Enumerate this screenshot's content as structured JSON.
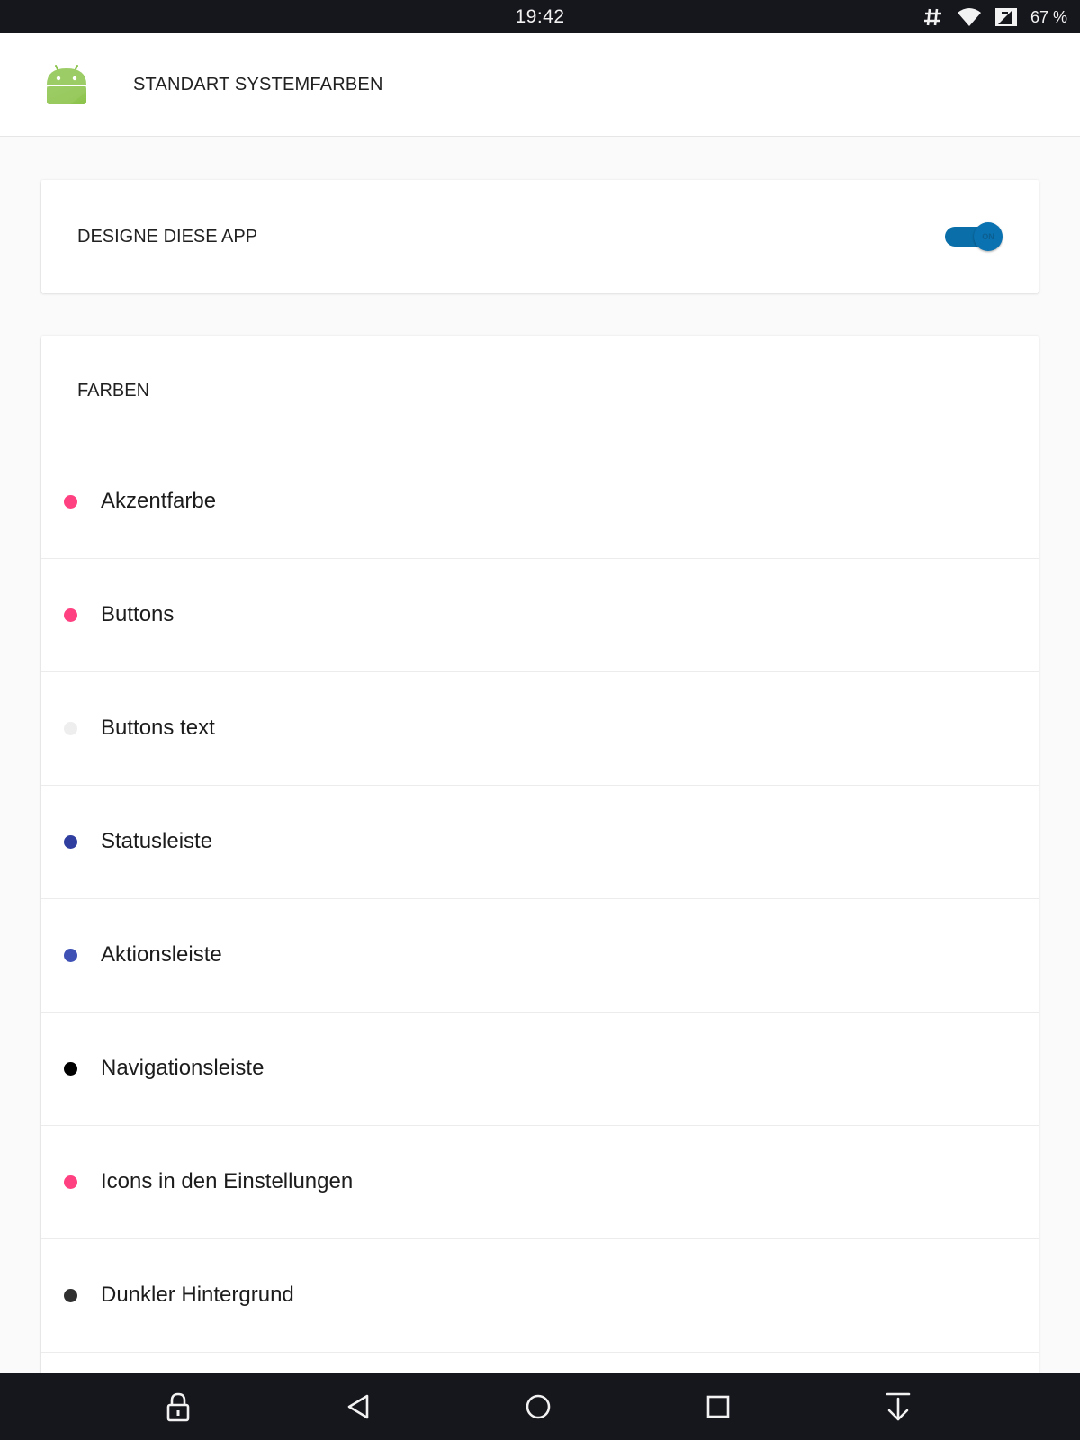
{
  "status_bar": {
    "time": "19:42",
    "battery": "67 %",
    "icons": [
      "hash-icon",
      "wifi-icon",
      "no-sim-icon"
    ]
  },
  "header": {
    "title": "STANDART SYSTEMFARBEN",
    "logo": "android-logo"
  },
  "design_card": {
    "label": "DESIGNE DIESE APP",
    "toggle": {
      "state": "ON",
      "checked": true,
      "color": "#0a72b0"
    }
  },
  "colors_card": {
    "title": "FARBEN",
    "items": [
      {
        "label": "Akzentfarbe",
        "color": "#ff4081"
      },
      {
        "label": "Buttons",
        "color": "#ff4081"
      },
      {
        "label": "Buttons text",
        "color": "#eeeeee"
      },
      {
        "label": "Statusleiste",
        "color": "#303f9f"
      },
      {
        "label": "Aktionsleiste",
        "color": "#3f51b5"
      },
      {
        "label": "Navigationsleiste",
        "color": "#000000"
      },
      {
        "label": "Icons in den Einstellungen",
        "color": "#ff4081"
      },
      {
        "label": "Dunkler Hintergrund",
        "color": "#303030"
      }
    ]
  },
  "nav_bar": {
    "buttons": [
      "lock-icon",
      "back-icon",
      "home-icon",
      "recents-icon",
      "download-icon"
    ]
  }
}
